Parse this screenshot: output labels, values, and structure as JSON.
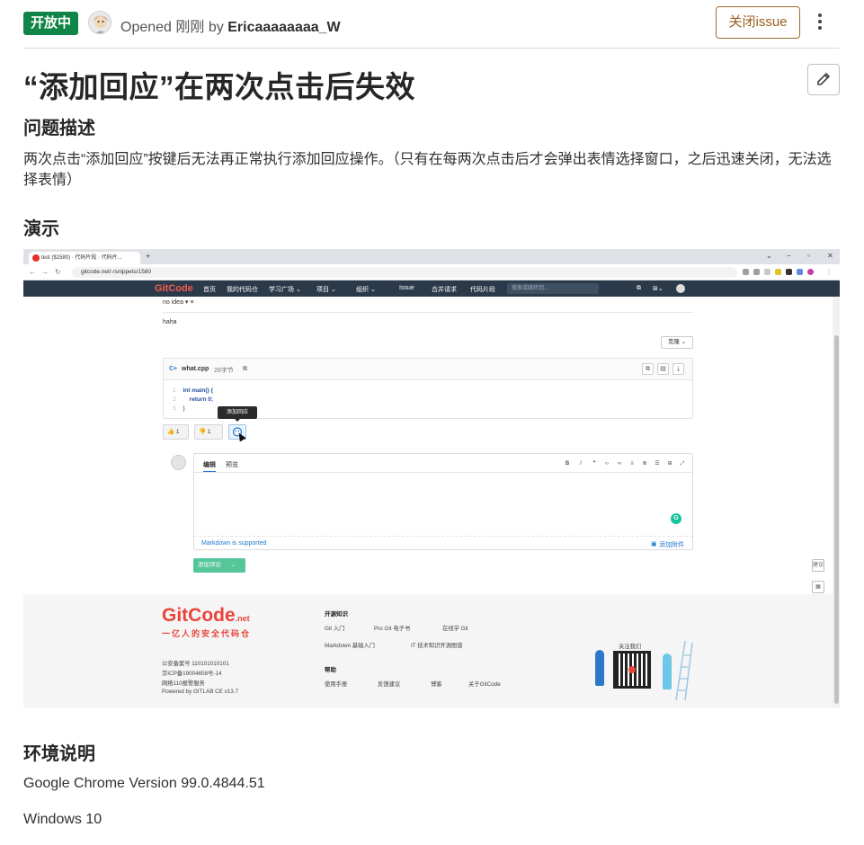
{
  "header": {
    "status": "开放中",
    "opened_label": "Opened",
    "time": "刚刚",
    "by_label": "by",
    "author": "Ericaaaaaaaa_W",
    "close_button": "关闭issue"
  },
  "title": "“添加回应”在两次点击后失效",
  "description": {
    "heading": "问题描述",
    "text": "两次点击“添加回应”按键后无法再正常执行添加回应操作。（只有在每两次点击后才会弹出表情选择窗口，之后迅速关闭，无法选择表情）"
  },
  "demo": {
    "heading": "演示",
    "screenshot": {
      "tab_title": "test ($1580) · 代码片段 · 代码片...",
      "url": "gitcode.net/-/snippets/1580",
      "nav": {
        "logo": "GitCode",
        "items": [
          "首页",
          "我的代码仓",
          "学习广场 ⌄",
          "项目 ⌄",
          "组织 ⌄",
          "Issue",
          "合并请求",
          "代码片段"
        ],
        "search_placeholder": "搜索或跳转到..."
      },
      "content": {
        "no_idea": "no idea ▾ ≡",
        "haha": "haha",
        "clone": "克隆 ⌄",
        "file_name": "what.cpp",
        "file_size": "28字节",
        "code": [
          "int main() {",
          "    return 0;",
          "}"
        ],
        "line_numbers": [
          "1",
          "2",
          "3"
        ],
        "tooltip": "添加回应",
        "thumbs_up": "1",
        "thumbs_down": "1",
        "editor_tabs": [
          "编辑",
          "预览"
        ],
        "markdown_note": "Markdown is supported",
        "attach": "添加附件",
        "submit": "添加评论",
        "side_feedback": "建议"
      },
      "footer": {
        "logo": "GitCode",
        "logo_suffix": ".net",
        "slogan": "一亿人的安全代码仓",
        "record_lines": [
          "公安备案号 110101010101",
          "京ICP备19004658号-14",
          "网络110报警服务",
          "Powered by GITLAB CE v13.7"
        ],
        "open_source_heading": "开源知识",
        "open_source_links": [
          "Git 入门",
          "Pro Git 电子书",
          "在线学 Git",
          "Markdown 基础入门",
          "IT 技术知识开源图谱"
        ],
        "help_heading": "帮助",
        "help_links": [
          "使用手册",
          "反馈建议",
          "博客",
          "关于GitCode"
        ],
        "follow": "关注我们"
      }
    }
  },
  "environment": {
    "heading": "环境说明",
    "browser": "Google Chrome Version 99.0.4844.51",
    "os": "Windows 10"
  },
  "colors": {
    "status_green": "#108548",
    "close_border": "#a06a2a",
    "nav_bg": "#2b3a4b",
    "brand_red": "#e8443a",
    "submit_green": "#55c59a"
  }
}
